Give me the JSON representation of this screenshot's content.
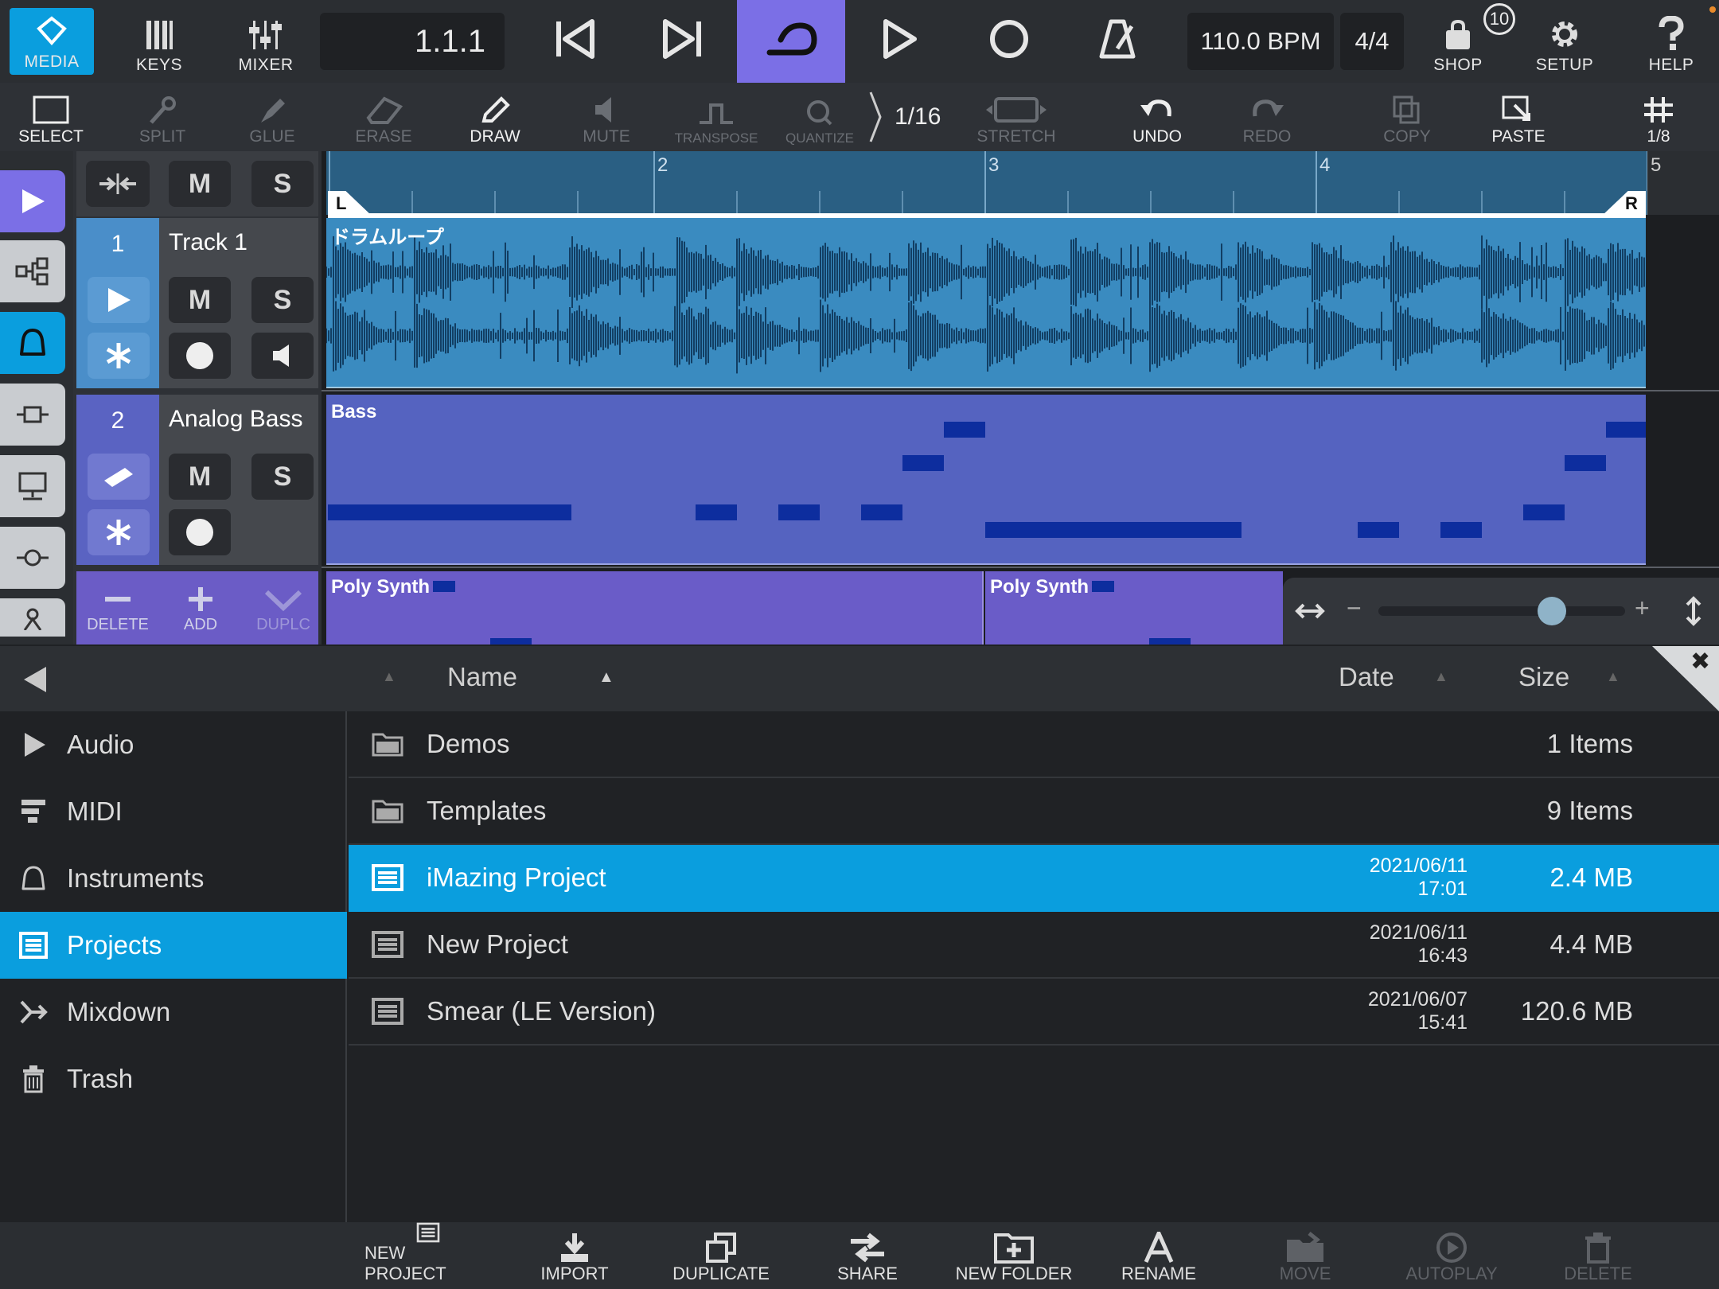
{
  "topbar": {
    "media": "MEDIA",
    "keys": "KEYS",
    "mixer": "MIXER",
    "position": "1.1.1",
    "tempo": "110.0 BPM",
    "signature": "4/4",
    "shop": "SHOP",
    "shop_badge": "10",
    "setup": "SETUP",
    "help": "HELP"
  },
  "toolbar": {
    "select": "SELECT",
    "split": "SPLIT",
    "glue": "GLUE",
    "erase": "ERASE",
    "draw": "DRAW",
    "mute": "MUTE",
    "transpose": "TRANSPOSE",
    "quantize": "QUANTIZE",
    "quantize_value": "1/16",
    "stretch": "STRETCH",
    "undo": "UNDO",
    "redo": "REDO",
    "copy": "COPY",
    "paste": "PASTE",
    "grid_value": "1/8"
  },
  "tracks": [
    {
      "number": "1",
      "name": "Track 1",
      "mute": "M",
      "solo": "S"
    },
    {
      "number": "2",
      "name": "Analog Bass",
      "mute": "M",
      "solo": "S"
    }
  ],
  "track_header": {
    "mute": "M",
    "solo": "S"
  },
  "track_actions": {
    "delete": "DELETE",
    "add": "ADD",
    "duplicate": "DUPLC"
  },
  "ruler": {
    "bars": [
      "2",
      "3",
      "4",
      "5"
    ],
    "left": "L",
    "right": "R"
  },
  "clips": {
    "drum": "ドラムループ",
    "bass": "Bass",
    "poly1": "Poly Synth",
    "poly2": "Poly Synth"
  },
  "browser": {
    "columns": {
      "name": "Name",
      "date": "Date",
      "size": "Size"
    },
    "sidebar": [
      {
        "label": "Audio",
        "icon": "play-triangle-icon"
      },
      {
        "label": "MIDI",
        "icon": "midi-icon"
      },
      {
        "label": "Instruments",
        "icon": "bell-icon"
      },
      {
        "label": "Projects",
        "icon": "document-icon",
        "selected": true
      },
      {
        "label": "Mixdown",
        "icon": "mixdown-icon"
      },
      {
        "label": "Trash",
        "icon": "trash-icon"
      }
    ],
    "rows": [
      {
        "name": "Demos",
        "date": "",
        "time": "",
        "size": "1 Items",
        "type": "folder"
      },
      {
        "name": "Templates",
        "date": "",
        "time": "",
        "size": "9 Items",
        "type": "folder"
      },
      {
        "name": "iMazing Project",
        "date": "2021/06/11",
        "time": "17:01",
        "size": "2.4 MB",
        "type": "project",
        "selected": true
      },
      {
        "name": "New Project",
        "date": "2021/06/11",
        "time": "16:43",
        "size": "4.4 MB",
        "type": "project"
      },
      {
        "name": "Smear (LE Version)",
        "date": "2021/06/07",
        "time": "15:41",
        "size": "120.6 MB",
        "type": "project"
      }
    ]
  },
  "bottombar": {
    "new_project": "NEW PROJECT",
    "import": "IMPORT",
    "duplicate": "DUPLICATE",
    "share": "SHARE",
    "new_folder": "NEW FOLDER",
    "rename": "RENAME",
    "move": "MOVE",
    "autoplay": "AUTOPLAY",
    "delete": "DELETE"
  },
  "colors": {
    "accent": "#0a9ede",
    "loop_active": "#7b6fe6",
    "drum_clip": "#3a8bc0",
    "bass_clip": "#5563c0",
    "poly_clip": "#6a5cc8",
    "midi_note": "#0d2d9e"
  }
}
